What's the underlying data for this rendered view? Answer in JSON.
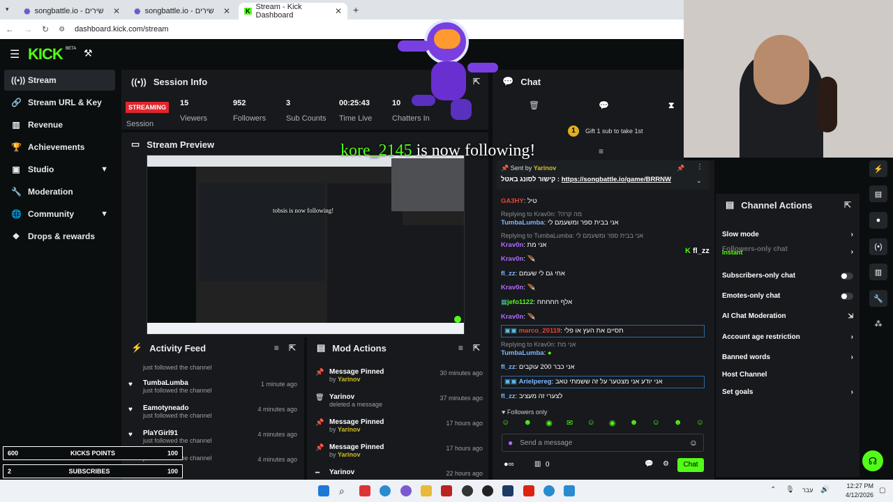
{
  "browser": {
    "tabs": [
      {
        "label": "songbattle.io - שירים"
      },
      {
        "label": "songbattle.io - שירים"
      },
      {
        "label": "Stream - Kick Dashboard"
      }
    ],
    "url": "dashboard.kick.com/stream"
  },
  "brand": {
    "logo": "KICK",
    "beta": "BETA",
    "accent": "#53fc18"
  },
  "sidebar": {
    "items": [
      {
        "label": "Stream"
      },
      {
        "label": "Stream URL & Key"
      },
      {
        "label": "Revenue"
      },
      {
        "label": "Achievements"
      },
      {
        "label": "Studio"
      },
      {
        "label": "Moderation"
      },
      {
        "label": "Community"
      },
      {
        "label": "Drops & rewards"
      }
    ]
  },
  "session": {
    "title": "Session Info",
    "status": "STREAMING",
    "status_label": "Session",
    "stats": [
      {
        "value": "15",
        "label": "Viewers"
      },
      {
        "value": "952",
        "label": "Followers"
      },
      {
        "value": "3",
        "label": "Sub Counts"
      },
      {
        "value": "00:25:43",
        "label": "Time Live"
      },
      {
        "value": "10",
        "label": "Chatters In"
      }
    ]
  },
  "preview": {
    "title": "Stream Preview"
  },
  "overlay": {
    "follow_name": "kore_2145",
    "follow_text": " is now following!",
    "mini_follow": "tobsis is now following!",
    "ticker_user": "fl_zz"
  },
  "activity": {
    "title": "Activity Feed",
    "top_text": "just followed the channel",
    "rows": [
      {
        "name": "TumbaLumba",
        "sub": "just followed the channel",
        "time": "1 minute ago"
      },
      {
        "name": "Eamotyneado",
        "sub": "just followed the channel",
        "time": "4 minutes ago"
      },
      {
        "name": "PlaYGirl91",
        "sub": "just followed the channel",
        "time": "4 minutes ago"
      },
      {
        "name": "",
        "sub": "just followed the channel",
        "time": "4 minutes ago"
      }
    ]
  },
  "mod": {
    "title": "Mod Actions",
    "rows": [
      {
        "name": "Message Pinned",
        "by": "by",
        "user": "Yarinov",
        "time": "30 minutes ago"
      },
      {
        "name": "Yarinov",
        "sub": "deleted a message",
        "time": "37 minutes ago"
      },
      {
        "name": "Message Pinned",
        "by": "by",
        "user": "Yarinov",
        "time": "17 hours ago"
      },
      {
        "name": "Message Pinned",
        "by": "by",
        "user": "Yarinov",
        "time": "17 hours ago"
      },
      {
        "name": "Yarinov",
        "sub": "",
        "time": "22 hours ago"
      }
    ]
  },
  "chat": {
    "title": "Chat",
    "gift_count": "1",
    "gift_text": "Gift 1 sub to take 1st",
    "sent_by": "Sent by",
    "sent_user": "Yarinov",
    "pinned_prefix": "קישור לסונג באטל : ",
    "pinned_link": "https://songbattle.io/game/BRRNW",
    "lines": [
      {
        "user": "GA3HY",
        "text": "טיל",
        "color": "#e0483d"
      },
      {
        "reply": "Replying to Krav0n: ?מה קרה"
      },
      {
        "user": "TumbaLumba",
        "text": "אני בבית ספר ומשעמם לי",
        "color": "#7fb7ff"
      },
      {
        "reply": "Replying to TumbaLumba: אני בבית ספר ומשעמם לי"
      },
      {
        "user": "Krav0n",
        "text": "אני מת",
        "color": "#b06bff"
      },
      {
        "user": "Krav0n",
        "text": "",
        "color": "#b06bff"
      },
      {
        "user": "fl_zz",
        "text": "אחי גם לי שעמם",
        "color": "#7fb7ff"
      },
      {
        "user": "Krav0n",
        "text": "",
        "color": "#b06bff"
      },
      {
        "user": "jefo1122",
        "text": "אלף חחחחח",
        "color": "#53fc18"
      },
      {
        "user": "Krav0n",
        "text": "",
        "color": "#b06bff"
      },
      {
        "user": "marco_20119",
        "text": "תסיים את העץ או פלי",
        "color": "#e0483d"
      },
      {
        "reply": "Replying to Krav0n: אני מת"
      },
      {
        "user": "TumbaLumba",
        "text": "",
        "color": "#7fb7ff"
      },
      {
        "user": "fl_zz",
        "text": "אני כבר 200 עוקבים",
        "color": "#7fb7ff"
      },
      {
        "user": "Arielpereg",
        "text": "אני יודע אני מצטער על זה ששמתי טאב",
        "color": "#7fb7ff"
      },
      {
        "user": "fl_zz",
        "text": "לצערי זה מעציב",
        "color": "#7fb7ff"
      }
    ],
    "followers_only": "Followers only",
    "placeholder": "Send a message",
    "points": "0",
    "send": "Chat"
  },
  "actions": {
    "title": "Channel Actions",
    "slow_mode": "Slow mode",
    "slow_sub": "Instant",
    "rows": [
      "Subscribers-only chat",
      "Emotes-only chat",
      "AI Chat Moderation",
      "Account age restriction",
      "Banned words",
      "Host Channel",
      "Set goals"
    ],
    "hidden_row": "Followers-only chat"
  },
  "goals": [
    {
      "left": "600",
      "label": "KICKS POINTS",
      "right": "100"
    },
    {
      "left": "2",
      "label": "SUBSCRIBES",
      "right": "100"
    }
  ],
  "taskbar": {
    "lang": "עבר",
    "time": "12:27 PM",
    "date": "4/12/2026"
  }
}
